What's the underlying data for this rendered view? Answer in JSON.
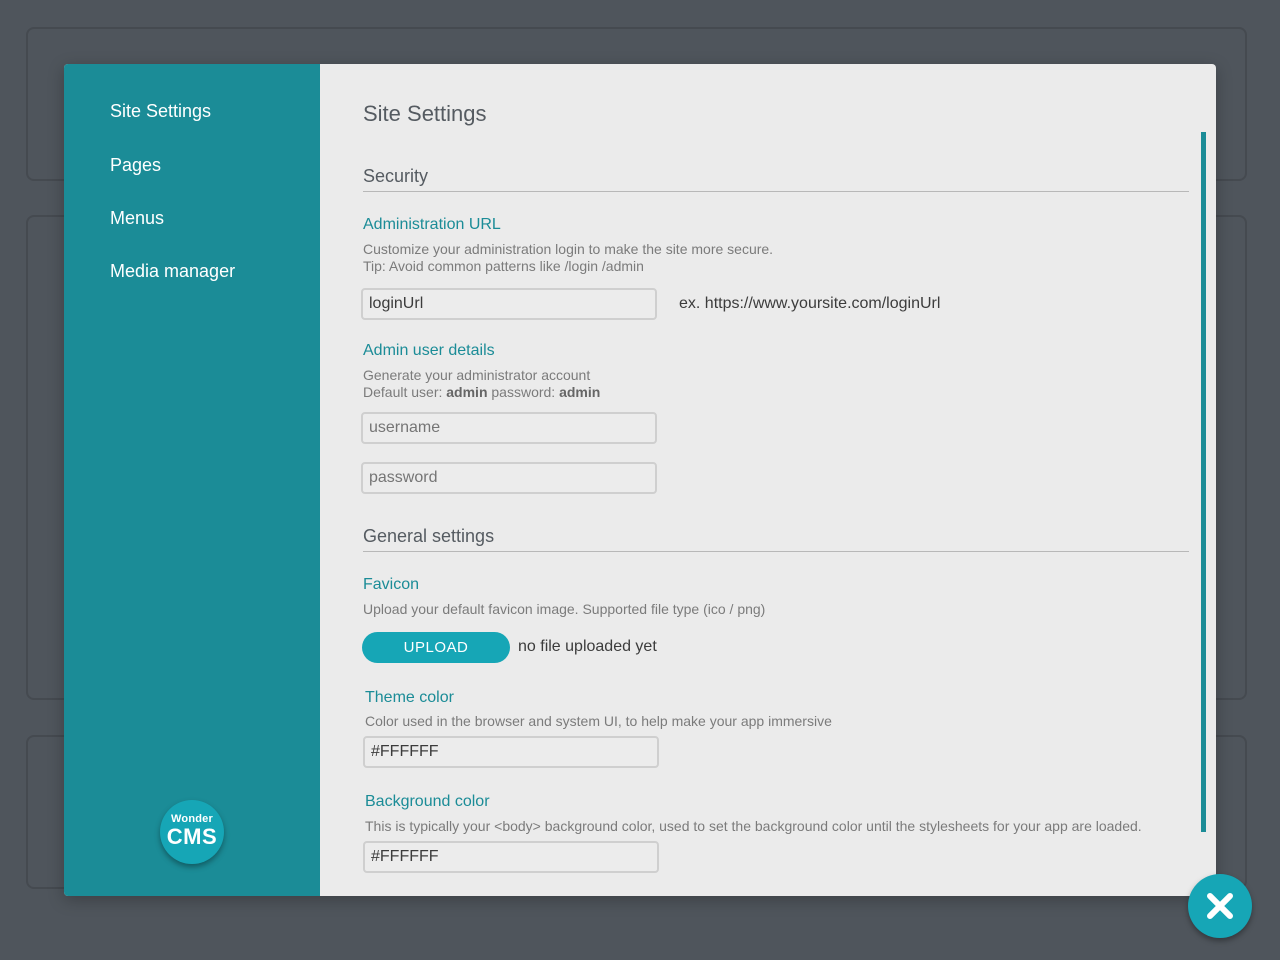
{
  "sidebar": {
    "items": [
      {
        "label": "Site Settings"
      },
      {
        "label": "Pages"
      },
      {
        "label": "Menus"
      },
      {
        "label": "Media manager"
      }
    ],
    "logo": {
      "line1": "Wonder",
      "line2": "CMS"
    }
  },
  "main": {
    "title": "Site Settings",
    "security": {
      "title": "Security",
      "admin_url": {
        "label": "Administration URL",
        "help1": "Customize your administration login to make the site more secure.",
        "help2": "Tip: Avoid common patterns like /login /admin",
        "value": "loginUrl",
        "example": "ex. https://www.yoursite.com/loginUrl"
      },
      "admin_user": {
        "label": "Admin user details",
        "help1": "Generate your administrator account",
        "help2_prefix": "Default user: ",
        "help2_user": "admin",
        "help2_mid": " password: ",
        "help2_pass": "admin",
        "username_placeholder": "username",
        "password_placeholder": "password"
      }
    },
    "general": {
      "title": "General settings",
      "favicon": {
        "label": "Favicon",
        "help": "Upload your default favicon  image. Supported file type (ico / png)",
        "upload_label": "UPLOAD",
        "status": "no file uploaded yet"
      },
      "theme_color": {
        "label": "Theme color",
        "help": "Color used in the browser and system UI, to help make your app immersive",
        "value": "#FFFFFF"
      },
      "background_color": {
        "label": "Background color",
        "help": "This is typically your <body> background color, used to set the background color until the stylesheets for your app are loaded.",
        "value": "#FFFFFF"
      }
    }
  },
  "icons": {
    "close": "close-icon"
  },
  "colors": {
    "accent": "#1b8c97",
    "button": "#16a6b6",
    "backdrop": "#4f555c",
    "modal_bg": "#ebebeb"
  }
}
